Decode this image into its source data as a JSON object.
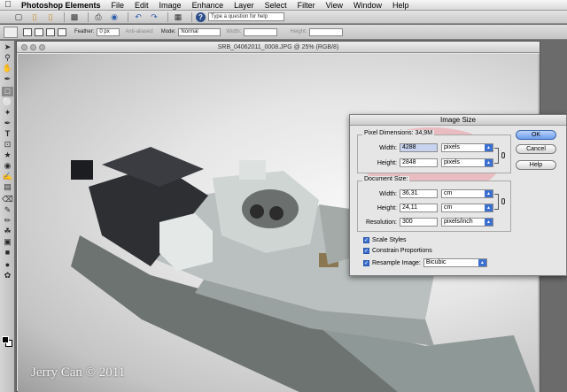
{
  "menubar": {
    "app": "Photoshop Elements",
    "items": [
      "File",
      "Edit",
      "Image",
      "Enhance",
      "Layer",
      "Select",
      "Filter",
      "View",
      "Window",
      "Help"
    ]
  },
  "shortcuts": {
    "icons": [
      "new-icon",
      "open-icon",
      "browse-icon",
      "save-icon",
      "print-icon",
      "online-print-icon",
      "undo-icon",
      "redo-icon",
      "palette-icon"
    ],
    "help_placeholder": "Type a question for help"
  },
  "options": {
    "feather_label": "Feather:",
    "feather_value": "0 px",
    "antialiased_label": "Anti-aliased",
    "mode_label": "Mode:",
    "mode_value": "Normal",
    "width_label": "Width:",
    "height_label": "Height:"
  },
  "document": {
    "title": "SRB_04062011_0008.JPG @ 25% (RGB/8)",
    "copyright": "Jerry Can © 2011"
  },
  "dialog": {
    "title": "Image Size",
    "pixel_dimensions_label": "Pixel Dimensions: 34,9M",
    "pixel_width_label": "Width:",
    "pixel_width_value": "4288",
    "pixel_width_unit": "pixels",
    "pixel_height_label": "Height:",
    "pixel_height_value": "2848",
    "pixel_height_unit": "pixels",
    "document_size_label": "Document Size:",
    "doc_width_label": "Width:",
    "doc_width_value": "36,31",
    "doc_width_unit": "cm",
    "doc_height_label": "Height:",
    "doc_height_value": "24,11",
    "doc_height_unit": "cm",
    "resolution_label": "Resolution:",
    "resolution_value": "300",
    "resolution_unit": "pixels/inch",
    "scale_styles": "Scale Styles",
    "constrain": "Constrain Proportions",
    "resample_label": "Resample Image:",
    "resample_value": "Bicubic",
    "ok": "OK",
    "cancel": "Cancel",
    "help": "Help",
    "highlight_color": "#ec6e78",
    "default_button_color": "#6a9ceb"
  }
}
